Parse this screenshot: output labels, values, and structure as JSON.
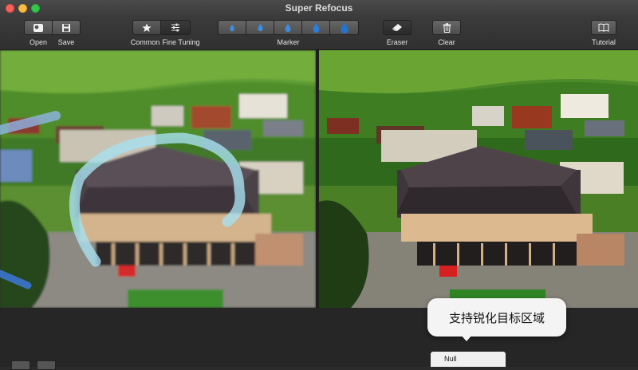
{
  "window": {
    "title": "Super Refocus"
  },
  "toolbar": {
    "open_label": "Open",
    "save_label": "Save",
    "common_label": "Common",
    "fine_tuning_label": "Fine Tuning",
    "marker_label": "Marker",
    "eraser_label": "Eraser",
    "clear_label": "Clear",
    "tutorial_label": "Tutorial"
  },
  "tooltip": {
    "text": "支持锐化目标区域"
  },
  "dropdown": {
    "selected": "Null"
  },
  "icons": {
    "open": "open-image-icon",
    "save": "floppy-disk-icon",
    "common": "star-icon",
    "fine_tuning": "sliders-icon",
    "marker": "water-drop-icon",
    "eraser": "eraser-icon",
    "clear": "trash-icon",
    "tutorial": "book-icon"
  },
  "colors": {
    "accent_drop": "#3b8de0",
    "marker_stroke": "#a8e0f0"
  }
}
